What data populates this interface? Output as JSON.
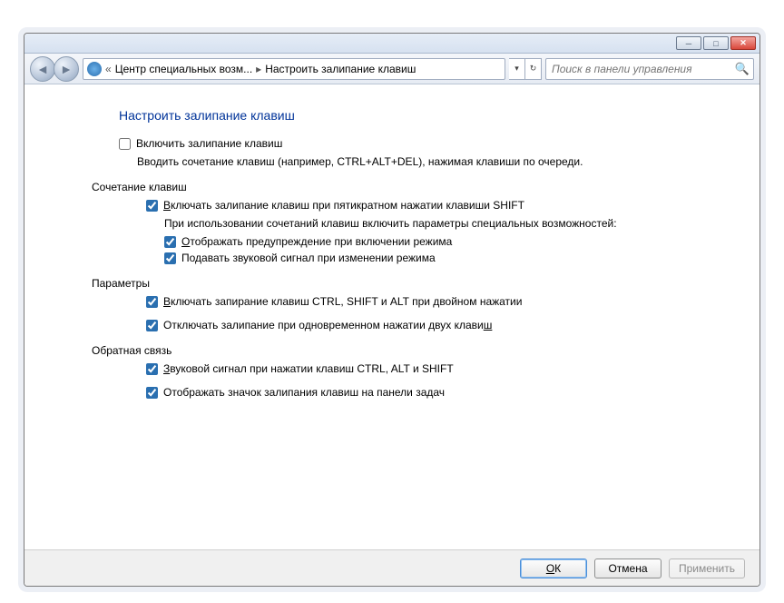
{
  "titlebar": {
    "minimize": "─",
    "maximize": "□",
    "close": "✕"
  },
  "nav": {
    "back_glyph": "◄",
    "forward_glyph": "►",
    "chevrons": "«",
    "crumb1": "Центр специальных возм...",
    "crumb_sep": "▸",
    "crumb2": "Настроить залипание клавиш",
    "dropdown_glyph": "▾",
    "refresh_glyph": "↻"
  },
  "search": {
    "placeholder": "Поиск в панели управления",
    "icon": "🔍"
  },
  "page": {
    "title": "Настроить залипание клавиш"
  },
  "main_checkbox": {
    "label": "Включить залипание клавиш",
    "desc": "Вводить сочетание клавиш (например, CTRL+ALT+DEL), нажимая клавиши по очереди."
  },
  "section_shortcut": {
    "heading": "Сочетание клавиш",
    "opt1_pre": "В",
    "opt1_rest": "ключать залипание клавиш при пятикратном нажатии клавиши SHIFT",
    "subtext": "При использовании сочетаний клавиш включить параметры специальных возможностей:",
    "opt2_pre": "О",
    "opt2_rest": "тображать предупреждение при включении режима",
    "opt3_label": "Подавать звуковой сигнал при изменении режима"
  },
  "section_params": {
    "heading": "Параметры",
    "opt1_pre": "В",
    "opt1_rest": "ключать запирание клавиш CTRL, SHIFT и ALT при двойном нажатии",
    "opt2_pre": "Отключать залипание при одновременном нажатии двух клави",
    "opt2_u": "ш"
  },
  "section_feedback": {
    "heading": "Обратная связь",
    "opt1_pre": "З",
    "opt1_rest": "вуковой сигнал при нажатии клавиш CTRL, ALT и SHIFT",
    "opt2_label": "Отображать значок залипания клавиш на панели задач"
  },
  "footer": {
    "ok_pre": "О",
    "ok_rest": "К",
    "cancel": "Отмена",
    "apply": "Применить"
  }
}
